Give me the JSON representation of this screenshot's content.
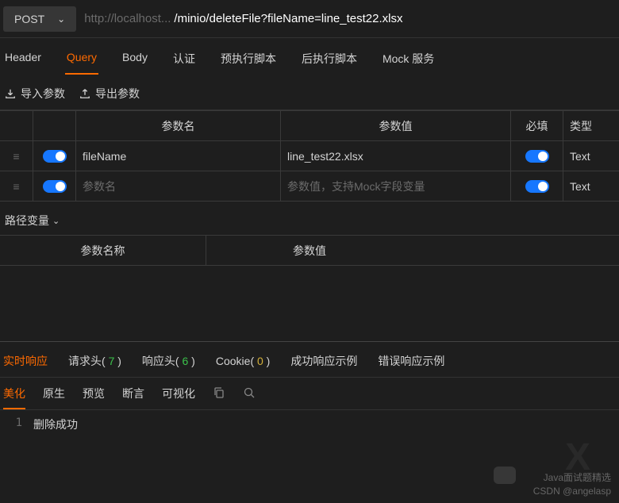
{
  "request": {
    "method": "POST",
    "url_dim": "http://localhost...",
    "url_bright": "/minio/deleteFile?fileName=line_test22.xlsx"
  },
  "tabs": {
    "header": "Header",
    "query": "Query",
    "body": "Body",
    "auth": "认证",
    "prescript": "预执行脚本",
    "postscript": "后执行脚本",
    "mock": "Mock 服务",
    "active": "query"
  },
  "io": {
    "import": "导入参数",
    "export": "导出参数"
  },
  "param_table": {
    "headers": {
      "name": "参数名",
      "value": "参数值",
      "required": "必填",
      "type": "类型"
    },
    "placeholders": {
      "name": "参数名",
      "value": "参数值，支持Mock字段变量"
    },
    "rows": [
      {
        "name": "fileName",
        "value": "line_test22.xlsx",
        "type": "Text"
      },
      {
        "name": "",
        "value": "",
        "type": "Text"
      }
    ]
  },
  "pathvar": {
    "label": "路径变量",
    "headers": {
      "name": "参数名称",
      "value": "参数值"
    }
  },
  "response": {
    "tabs": {
      "realtime": "实时响应",
      "req_headers": "请求头",
      "req_count": "7",
      "resp_headers": "响应头",
      "resp_count": "6",
      "cookie": "Cookie",
      "cookie_count": "0",
      "success_ex": "成功响应示例",
      "error_ex": "错误响应示例"
    },
    "views": {
      "beautify": "美化",
      "raw": "原生",
      "preview": "预览",
      "assert": "断言",
      "viz": "可视化"
    },
    "body_lines": [
      "删除成功"
    ]
  },
  "watermark": {
    "line1": "Java面试题精选",
    "line2": "CSDN @angelasp"
  }
}
